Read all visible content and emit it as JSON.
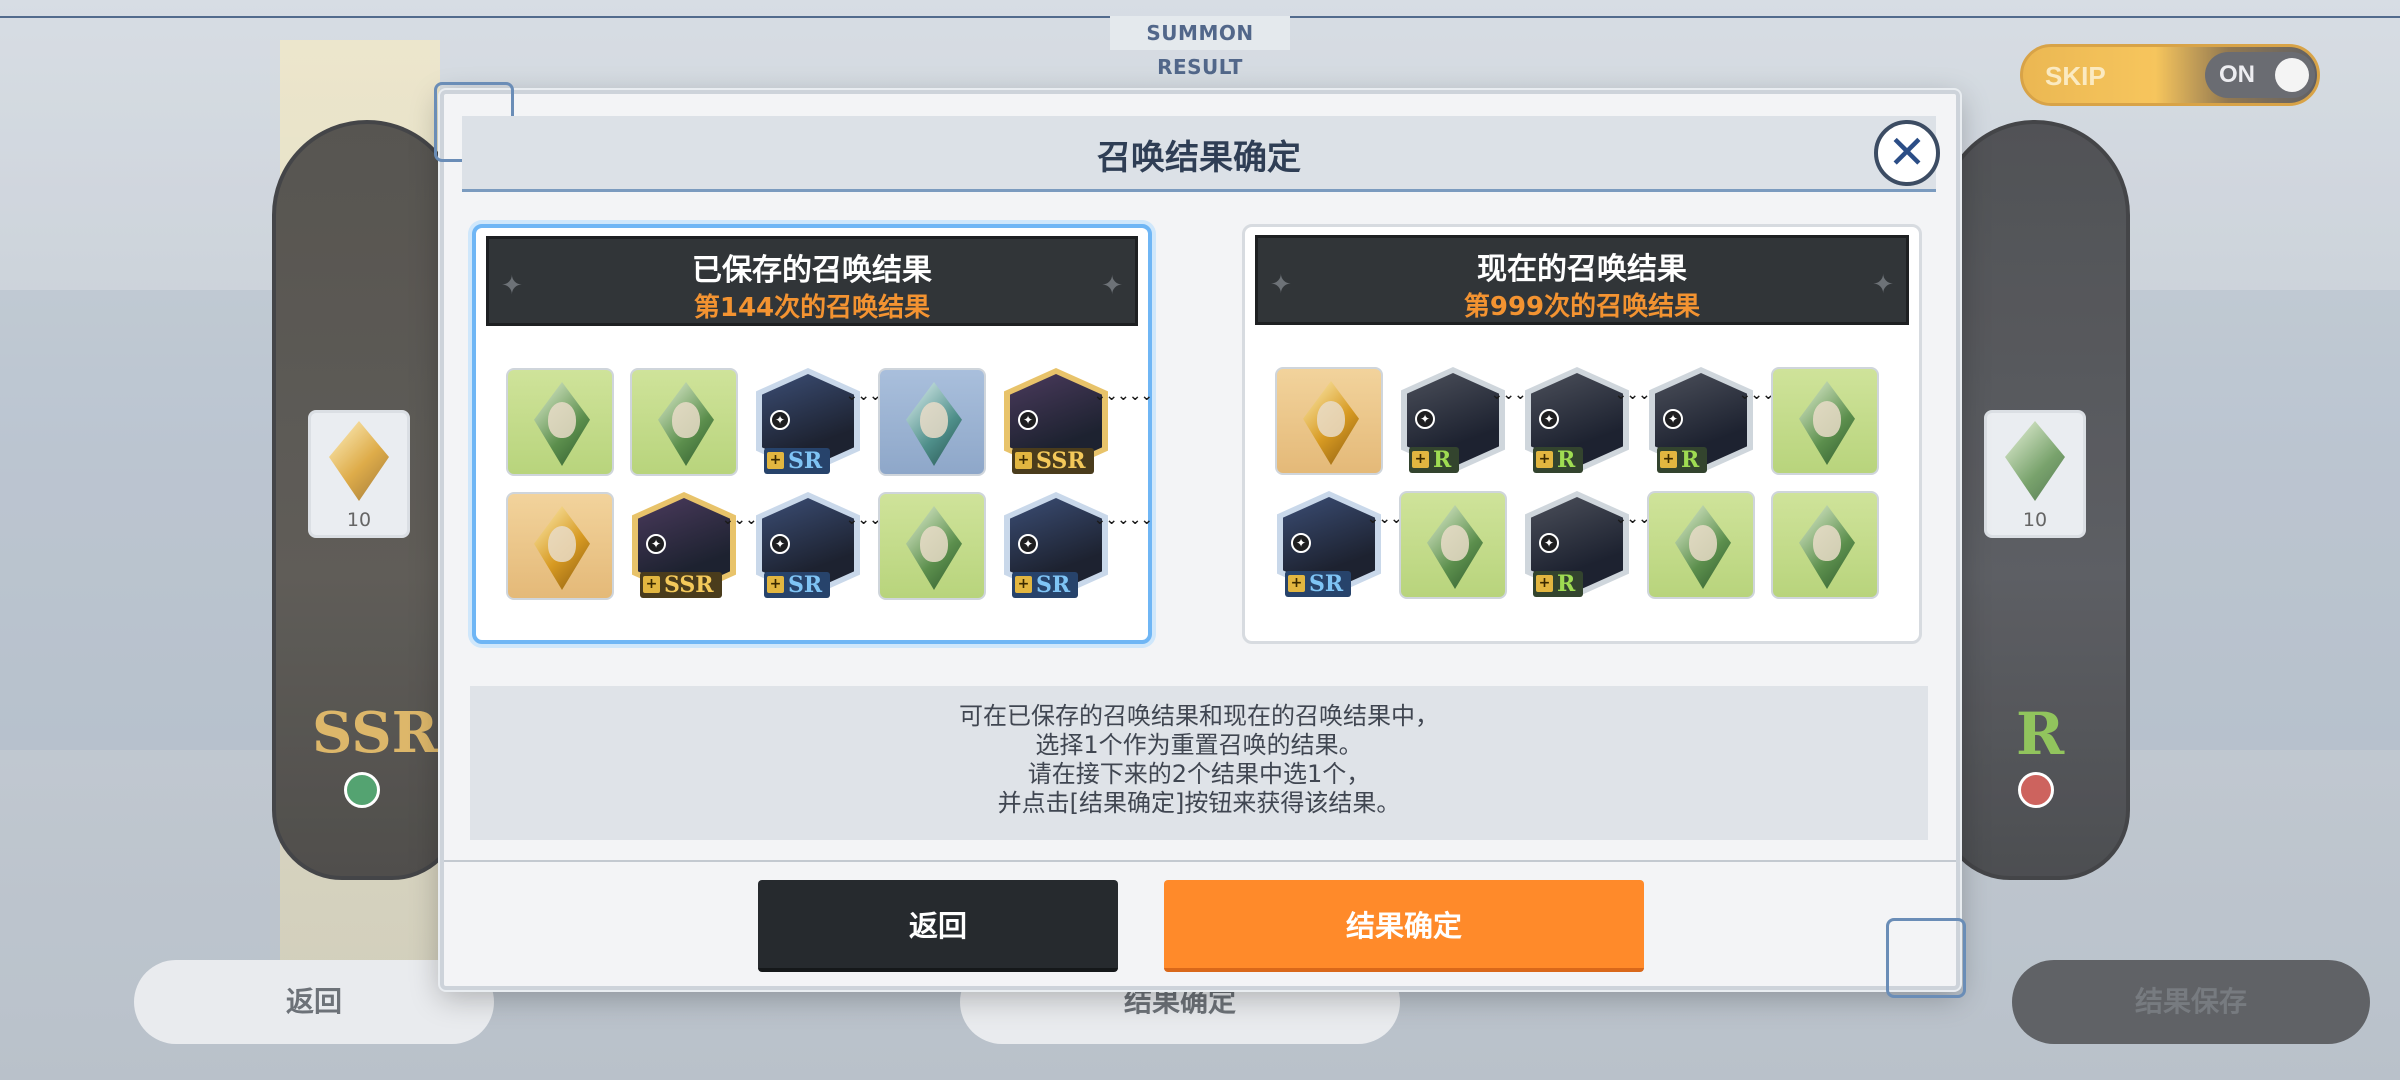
{
  "background": {
    "title": "SUMMON RESULT",
    "skip": {
      "label": "SKIP",
      "state": "ON"
    },
    "left_card": {
      "rank": "SSR",
      "count": "10"
    },
    "right_card": {
      "rank": "R",
      "count": "10"
    },
    "buttons": {
      "back": "返回",
      "confirm": "结果确定",
      "save": "结果保存"
    }
  },
  "modal": {
    "title": "召唤结果确定",
    "saved": {
      "title": "已保存的召唤结果",
      "subtitle": "第144次的召唤结果",
      "items": [
        {
          "type": "crystal",
          "color": "green"
        },
        {
          "type": "crystal",
          "color": "green"
        },
        {
          "type": "card",
          "rarity": "SR"
        },
        {
          "type": "crystal",
          "color": "blue"
        },
        {
          "type": "card",
          "rarity": "SSR"
        },
        {
          "type": "crystal",
          "color": "gold"
        },
        {
          "type": "card",
          "rarity": "SSR"
        },
        {
          "type": "card",
          "rarity": "SR"
        },
        {
          "type": "crystal",
          "color": "green"
        },
        {
          "type": "card",
          "rarity": "SR"
        }
      ]
    },
    "current": {
      "title": "现在的召唤结果",
      "subtitle": "第999次的召唤结果",
      "items": [
        {
          "type": "crystal",
          "color": "gold"
        },
        {
          "type": "card",
          "rarity": "R"
        },
        {
          "type": "card",
          "rarity": "R"
        },
        {
          "type": "card",
          "rarity": "R"
        },
        {
          "type": "crystal",
          "color": "green"
        },
        {
          "type": "card",
          "rarity": "SR"
        },
        {
          "type": "crystal",
          "color": "green"
        },
        {
          "type": "card",
          "rarity": "R"
        },
        {
          "type": "crystal",
          "color": "green"
        },
        {
          "type": "crystal",
          "color": "green"
        }
      ]
    },
    "info_lines": [
      "可在已保存的召唤结果和现在的召唤结果中，",
      "选择1个作为重置召唤的结果。",
      "请在接下来的2个结果中选1个，",
      "并点击[结果确定]按钮来获得该结果。"
    ],
    "buttons": {
      "back": "返回",
      "confirm": "结果确定"
    }
  },
  "colors": {
    "accent_orange": "#ff8a2a",
    "dark_button": "#262a2e",
    "selected_border": "#6fb6f5",
    "ssr_gold": "#f4c95a",
    "sr_blue": "#7fc4f5",
    "r_green": "#9fdc52"
  }
}
